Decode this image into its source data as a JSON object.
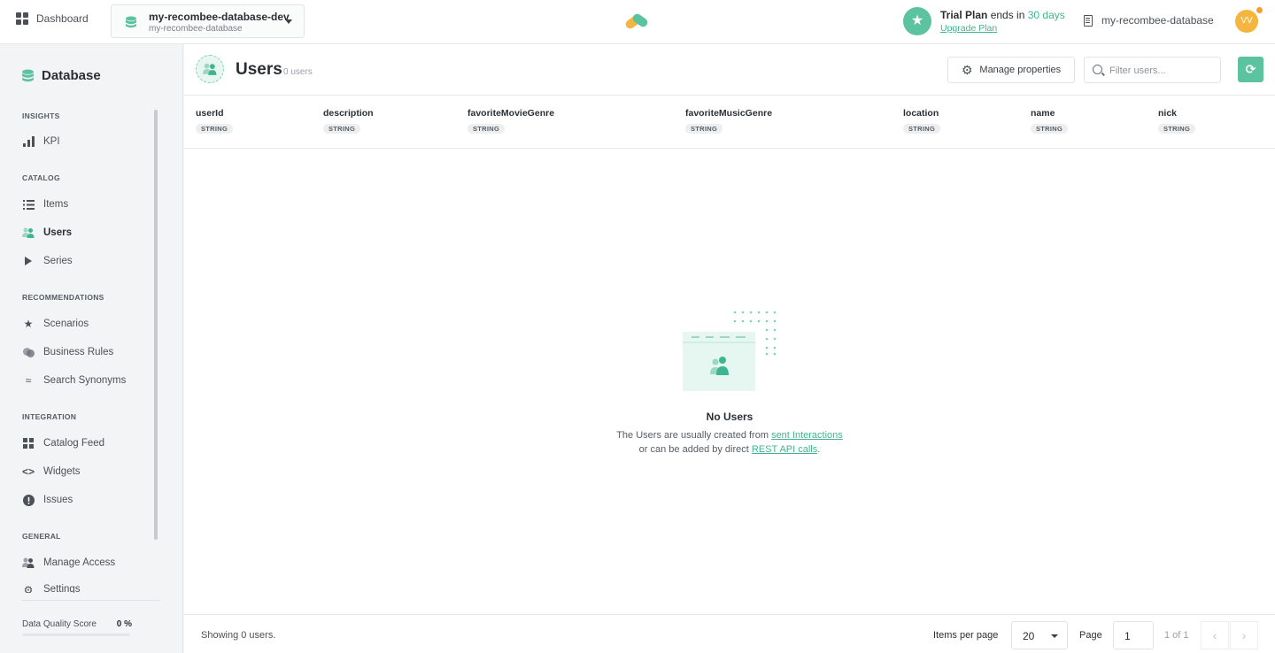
{
  "topbar": {
    "dashboard_label": "Dashboard",
    "db_name": "my-recombee-database-dev",
    "db_sub": "my-recombee-database",
    "trial_plan": "Trial Plan",
    "trial_ends": " ends in ",
    "trial_days": "30 days",
    "upgrade_label": "Upgrade Plan",
    "database_name": "my-recombee-database",
    "avatar_initials": "VV"
  },
  "sidebar": {
    "title": "Database",
    "sections": {
      "insights": "INSIGHTS",
      "catalog": "CATALOG",
      "recommendations": "RECOMMENDATIONS",
      "integration": "INTEGRATION",
      "general": "GENERAL"
    },
    "items": {
      "kpi": "KPI",
      "items": "Items",
      "users": "Users",
      "series": "Series",
      "scenarios": "Scenarios",
      "business_rules": "Business Rules",
      "search_synonyms": "Search Synonyms",
      "catalog_feed": "Catalog Feed",
      "widgets": "Widgets",
      "issues": "Issues",
      "manage_access": "Manage Access",
      "settings": "Settings"
    },
    "data_quality": {
      "label": "Data Quality Score",
      "value": "0 %",
      "fraction": 0
    }
  },
  "page": {
    "title": "Users",
    "count": "0 users",
    "manage_properties": "Manage properties",
    "filter_placeholder": "Filter users..."
  },
  "columns": [
    {
      "name": "userId",
      "type": "STRING"
    },
    {
      "name": "description",
      "type": "STRING"
    },
    {
      "name": "favoriteMovieGenre",
      "type": "STRING"
    },
    {
      "name": "favoriteMusicGenre",
      "type": "STRING"
    },
    {
      "name": "location",
      "type": "STRING"
    },
    {
      "name": "name",
      "type": "STRING"
    },
    {
      "name": "nick",
      "type": "STRING"
    }
  ],
  "empty": {
    "title": "No Users",
    "line1_prefix": "The Users are usually created from ",
    "line1_link": "sent Interactions",
    "line2_prefix": "or can be added by direct ",
    "line2_link": "REST API calls",
    "line2_suffix": "."
  },
  "footer": {
    "showing": "Showing 0 users.",
    "items_per_page_label": "Items per page",
    "items_per_page_value": "20",
    "page_label": "Page",
    "page_value": "1",
    "page_of": "1 of 1"
  },
  "colors": {
    "accent": "#5cc3a0",
    "link": "#3fb58f",
    "avatar": "#f4b63f"
  }
}
